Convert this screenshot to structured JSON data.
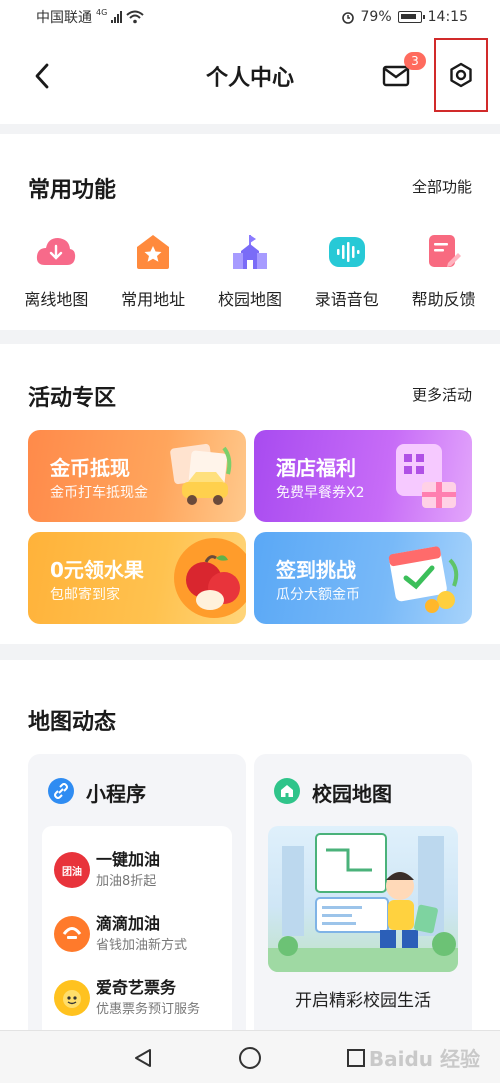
{
  "status_bar": {
    "carrier": "中国联通",
    "network": "4G",
    "battery": "79%",
    "time": "14:15"
  },
  "header": {
    "title": "个人中心",
    "mail_badge": "3"
  },
  "common_functions": {
    "title": "常用功能",
    "link": "全部功能",
    "items": [
      {
        "label": "离线地图",
        "icon": "download-cloud-icon"
      },
      {
        "label": "常用地址",
        "icon": "home-star-icon"
      },
      {
        "label": "校园地图",
        "icon": "school-building-icon"
      },
      {
        "label": "录语音包",
        "icon": "voice-wave-icon"
      },
      {
        "label": "帮助反馈",
        "icon": "feedback-edit-icon"
      }
    ]
  },
  "activities": {
    "title": "活动专区",
    "link": "更多活动",
    "cards": [
      {
        "title": "金币抵现",
        "subtitle": "金币打车抵现金"
      },
      {
        "title": "酒店福利",
        "subtitle": "免费早餐券X2"
      },
      {
        "title": "0元领水果",
        "subtitle": "包邮寄到家"
      },
      {
        "title": "签到挑战",
        "subtitle": "瓜分大额金币"
      }
    ]
  },
  "map_dynamics": {
    "title": "地图动态",
    "mini_programs": {
      "title": "小程序",
      "items": [
        {
          "name": "一键加油",
          "desc": "加油8折起",
          "logo_text": "团油"
        },
        {
          "name": "滴滴加油",
          "desc": "省钱加油新方式",
          "logo_text": ""
        },
        {
          "name": "爱奇艺票务",
          "desc": "优惠票务预订服务",
          "logo_text": ""
        }
      ]
    },
    "campus": {
      "title": "校园地图",
      "caption": "开启精彩校园生活"
    }
  },
  "watermark": "Baidu 经验",
  "colors": {
    "accent_red": "#ff6b5e",
    "highlight_box": "#d12a2a"
  }
}
